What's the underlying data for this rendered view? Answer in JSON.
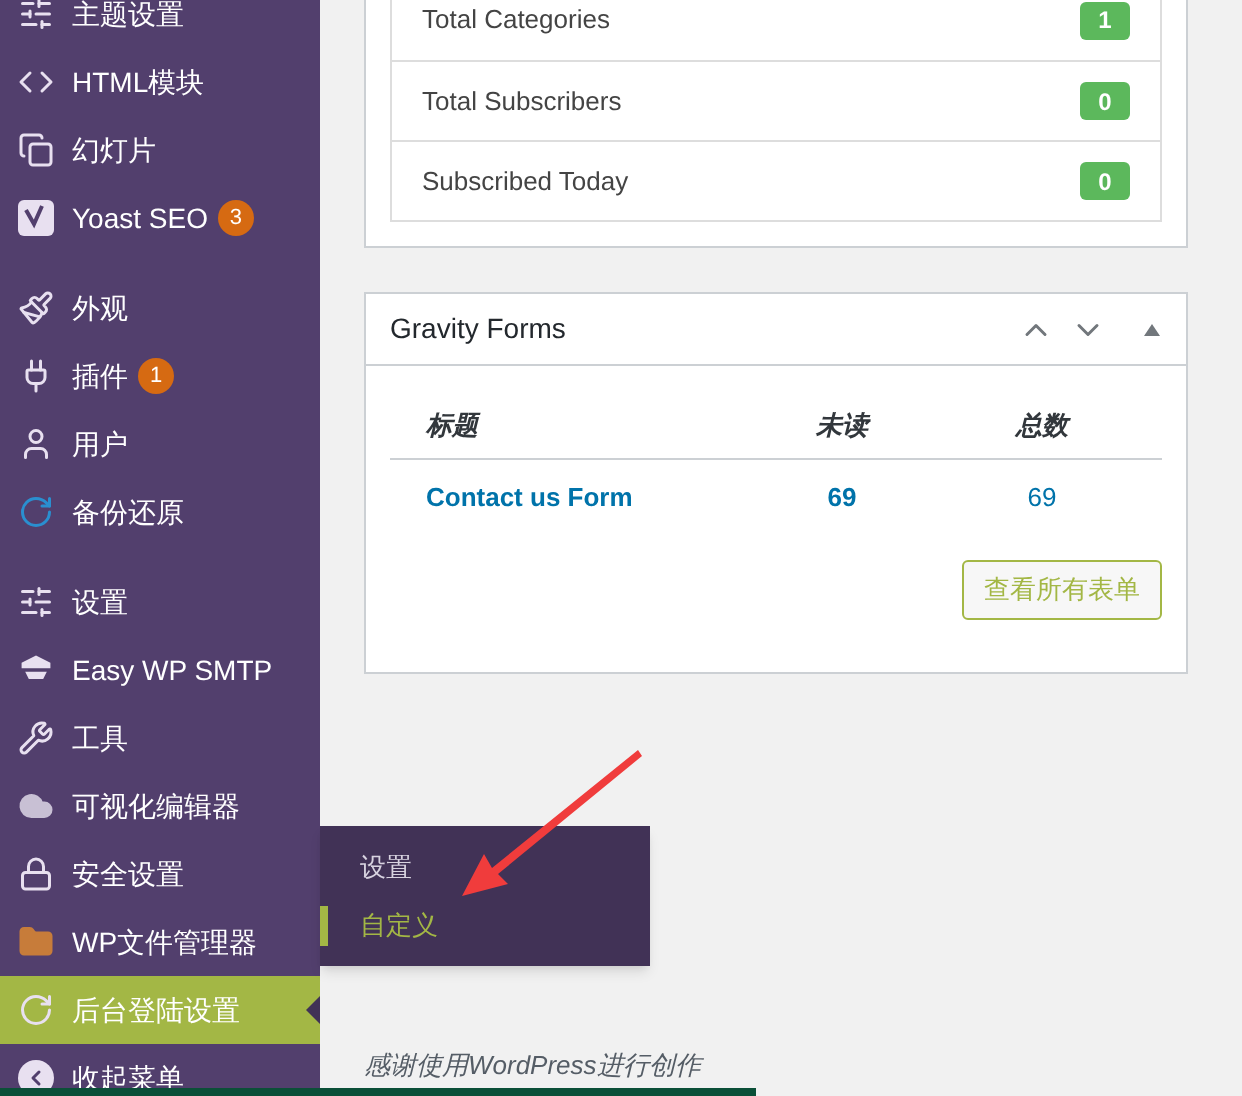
{
  "sidebar": {
    "groups": [
      [
        {
          "label": "主题设置",
          "selected": false
        },
        {
          "label": "HTML模块",
          "selected": false
        },
        {
          "label": "幻灯片",
          "selected": false
        },
        {
          "label": "Yoast SEO",
          "badge": "3",
          "selected": false
        }
      ],
      [
        {
          "label": "外观",
          "selected": false
        },
        {
          "label": "插件",
          "badge": "1",
          "selected": false
        },
        {
          "label": "用户",
          "selected": false
        },
        {
          "label": "备份还原",
          "selected": false
        }
      ],
      [
        {
          "label": "设置",
          "selected": false
        },
        {
          "label": "Easy WP SMTP",
          "selected": false
        },
        {
          "label": "工具",
          "selected": false
        },
        {
          "label": "可视化编辑器",
          "selected": false
        },
        {
          "label": "安全设置",
          "selected": false
        },
        {
          "label": "WP文件管理器",
          "selected": false
        },
        {
          "label": "后台登陆设置",
          "selected": true
        },
        {
          "label": "收起菜单",
          "selected": false
        }
      ]
    ]
  },
  "flyout": {
    "items": [
      {
        "label": "设置",
        "selected": false
      },
      {
        "label": "自定义",
        "selected": true
      }
    ]
  },
  "stats_widget": {
    "rows": [
      {
        "label": "Total Categories",
        "value": "1"
      },
      {
        "label": "Total Subscribers",
        "value": "0"
      },
      {
        "label": "Subscribed Today",
        "value": "0"
      }
    ]
  },
  "gravity_widget": {
    "title": "Gravity Forms",
    "columns": [
      "标题",
      "未读",
      "总数"
    ],
    "rows": [
      {
        "title": "Contact us Form",
        "unread": "69",
        "total": "69"
      }
    ],
    "button": "查看所有表单"
  },
  "footer": {
    "text": "感谢使用WordPress进行创作"
  }
}
